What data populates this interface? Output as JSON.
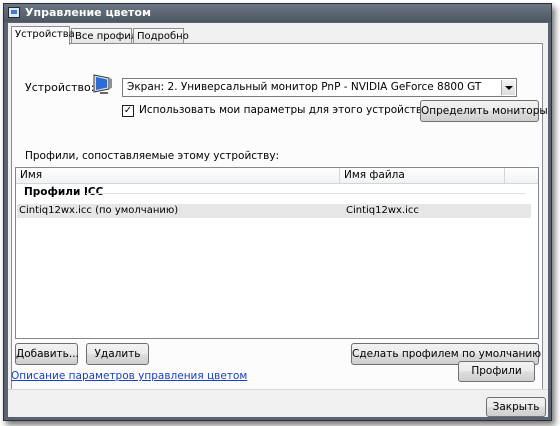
{
  "window": {
    "title": "Управление цветом"
  },
  "tabs": [
    {
      "label": "Устройства",
      "active": true
    },
    {
      "label": "Все профили",
      "active": false
    },
    {
      "label": "Подробно",
      "active": false
    }
  ],
  "device": {
    "label": "Устройство:",
    "selected": "Экран: 2. Универсальный монитор PnP - NVIDIA GeForce 8800 GT",
    "use_settings_label": "Использовать мои параметры для этого устройства",
    "use_settings_checked": "✓",
    "identify_button": "Определить мониторы"
  },
  "profiles": {
    "section_label": "Профили, сопоставляемые этому устройству:",
    "columns": [
      "Имя",
      "Имя файла"
    ],
    "group_title": "Профили ICC",
    "rows": [
      {
        "name": "Cintiq12wx.icc (по умолчанию)",
        "file": "Cintiq12wx.icc"
      }
    ],
    "add_button": "Добавить...",
    "remove_button": "Удалить",
    "set_default_button": "Сделать профилем по умолчанию"
  },
  "footer": {
    "help_link": "Описание параметров управления цветом",
    "profiles_button": "Профили",
    "close_button": "Закрыть"
  }
}
